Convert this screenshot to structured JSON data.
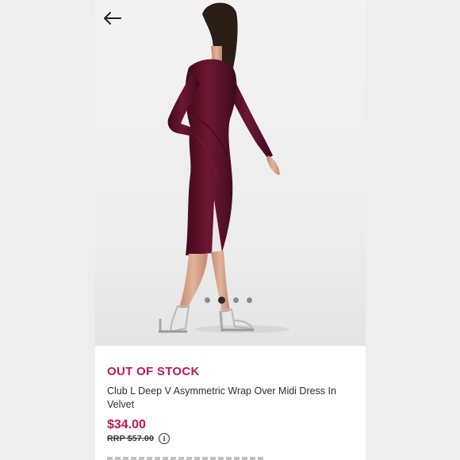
{
  "colors": {
    "accent": "#c1184f",
    "dress": "#5e1128"
  },
  "nav": {
    "back_icon": "arrow-left-icon"
  },
  "gallery": {
    "count": 4,
    "active_index": 1
  },
  "product": {
    "stock_status": "OUT OF STOCK",
    "title": "Club L Deep V Asymmetric Wrap Over Midi Dress In Velvet",
    "price": "$34.00",
    "rrp": "RRP $57.00",
    "rrp_info_icon": "info-icon"
  }
}
